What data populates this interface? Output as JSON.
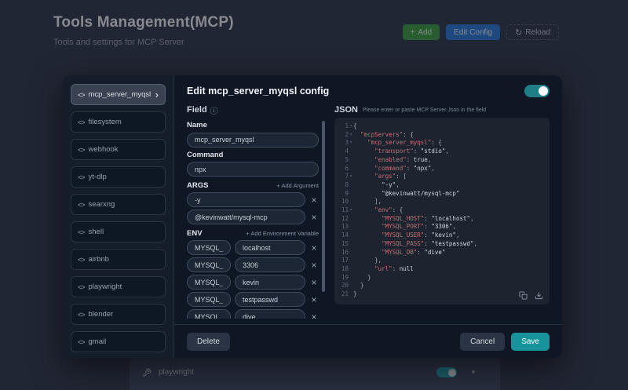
{
  "icons": {
    "code": "<>",
    "chevron": "›",
    "info": "ⓘ",
    "reload": "↻",
    "plus": "+",
    "caret": "▼",
    "close": "×",
    "fold": "▾"
  },
  "colors": {
    "accent_teal": "#18929b",
    "toggle_teal": "#1f7e87",
    "add_green": "#43a047",
    "edit_blue": "#2e7cd6",
    "key_red": "#c96b74"
  },
  "page": {
    "title": "Tools Management(MCP)",
    "subtitle": "Tools and settings for MCP Server",
    "buttons": {
      "add": "Add",
      "edit_config": "Edit Config",
      "reload": "Reload"
    }
  },
  "background": {
    "tool_row": {
      "label": "playwright",
      "toggle_on": true
    }
  },
  "modal": {
    "title": "Edit mcp_server_myqsl config",
    "toggle_on": true,
    "sidebar": {
      "items": [
        {
          "label": "mcp_server_myqsl",
          "selected": true
        },
        {
          "label": "filesystem",
          "selected": false
        },
        {
          "label": "webhook",
          "selected": false
        },
        {
          "label": "yt-dlp",
          "selected": false
        },
        {
          "label": "searxng",
          "selected": false
        },
        {
          "label": "shell",
          "selected": false
        },
        {
          "label": "airbnb",
          "selected": false
        },
        {
          "label": "playwright",
          "selected": false
        },
        {
          "label": "blender",
          "selected": false
        },
        {
          "label": "gmail",
          "selected": false
        }
      ]
    },
    "field": {
      "section_label": "Field",
      "name_label": "Name",
      "name_value": "mcp_server_myqsl",
      "command_label": "Command",
      "command_value": "npx",
      "args_label": "ARGS",
      "add_argument": "+ Add Argument",
      "args": [
        "-y",
        "@kevinwatt/mysql-mcp"
      ],
      "env_label": "ENV",
      "add_env": "+ Add Environment Variable",
      "env": [
        {
          "key": "MYSQL_HOST",
          "value": "localhost"
        },
        {
          "key": "MYSQL_PORT",
          "value": "3306"
        },
        {
          "key": "MYSQL_USER",
          "value": "kevin"
        },
        {
          "key": "MYSQL_PASS",
          "value": "testpasswd"
        },
        {
          "key": "MYSQL_DB",
          "value": "dive"
        }
      ]
    },
    "json_panel": {
      "label": "JSON",
      "hint": "Please enter or paste MCP Server Json in the field",
      "lines": [
        {
          "n": 1,
          "fold": true,
          "t": [
            [
              "p",
              "{"
            ]
          ]
        },
        {
          "n": 2,
          "fold": true,
          "t": [
            [
              "p",
              "  "
            ],
            [
              "k",
              "\"mcpServers\""
            ],
            [
              "p",
              ": {"
            ]
          ]
        },
        {
          "n": 3,
          "fold": true,
          "t": [
            [
              "p",
              "    "
            ],
            [
              "k",
              "\"mcp_server_myqsl\""
            ],
            [
              "p",
              ": {"
            ]
          ]
        },
        {
          "n": 4,
          "fold": false,
          "t": [
            [
              "p",
              "      "
            ],
            [
              "k",
              "\"transport\""
            ],
            [
              "p",
              ": "
            ],
            [
              "s",
              "\"stdio\""
            ],
            [
              "p",
              ","
            ]
          ]
        },
        {
          "n": 5,
          "fold": false,
          "t": [
            [
              "p",
              "      "
            ],
            [
              "k",
              "\"enabled\""
            ],
            [
              "p",
              ": "
            ],
            [
              "w",
              "true"
            ],
            [
              "p",
              ","
            ]
          ]
        },
        {
          "n": 6,
          "fold": false,
          "t": [
            [
              "p",
              "      "
            ],
            [
              "k",
              "\"command\""
            ],
            [
              "p",
              ": "
            ],
            [
              "s",
              "\"npx\""
            ],
            [
              "p",
              ","
            ]
          ]
        },
        {
          "n": 7,
          "fold": true,
          "t": [
            [
              "p",
              "      "
            ],
            [
              "k",
              "\"args\""
            ],
            [
              "p",
              ": ["
            ]
          ]
        },
        {
          "n": 8,
          "fold": false,
          "t": [
            [
              "p",
              "        "
            ],
            [
              "s",
              "\"-y\""
            ],
            [
              "p",
              ","
            ]
          ]
        },
        {
          "n": 9,
          "fold": false,
          "t": [
            [
              "p",
              "        "
            ],
            [
              "s",
              "\"@kevinwatt/mysql-mcp\""
            ]
          ]
        },
        {
          "n": 10,
          "fold": false,
          "t": [
            [
              "p",
              "      ],"
            ]
          ]
        },
        {
          "n": 11,
          "fold": true,
          "t": [
            [
              "p",
              "      "
            ],
            [
              "k",
              "\"env\""
            ],
            [
              "p",
              ": {"
            ]
          ]
        },
        {
          "n": 12,
          "fold": false,
          "t": [
            [
              "p",
              "        "
            ],
            [
              "k",
              "\"MYSQL_HOST\""
            ],
            [
              "p",
              ": "
            ],
            [
              "s",
              "\"localhost\""
            ],
            [
              "p",
              ","
            ]
          ]
        },
        {
          "n": 13,
          "fold": false,
          "t": [
            [
              "p",
              "        "
            ],
            [
              "k",
              "\"MYSQL_PORT\""
            ],
            [
              "p",
              ": "
            ],
            [
              "s",
              "\"3306\""
            ],
            [
              "p",
              ","
            ]
          ]
        },
        {
          "n": 14,
          "fold": false,
          "t": [
            [
              "p",
              "        "
            ],
            [
              "k",
              "\"MYSQL_USER\""
            ],
            [
              "p",
              ": "
            ],
            [
              "s",
              "\"kevin\""
            ],
            [
              "p",
              ","
            ]
          ]
        },
        {
          "n": 15,
          "fold": false,
          "t": [
            [
              "p",
              "        "
            ],
            [
              "k",
              "\"MYSQL_PASS\""
            ],
            [
              "p",
              ": "
            ],
            [
              "s",
              "\"testpasswd\""
            ],
            [
              "p",
              ","
            ]
          ]
        },
        {
          "n": 16,
          "fold": false,
          "t": [
            [
              "p",
              "        "
            ],
            [
              "k",
              "\"MYSQL_DB\""
            ],
            [
              "p",
              ": "
            ],
            [
              "s",
              "\"dive\""
            ]
          ]
        },
        {
          "n": 17,
          "fold": false,
          "t": [
            [
              "p",
              "      },"
            ]
          ]
        },
        {
          "n": 18,
          "fold": false,
          "t": [
            [
              "p",
              "      "
            ],
            [
              "k",
              "\"url\""
            ],
            [
              "p",
              ": "
            ],
            [
              "w",
              "null"
            ]
          ]
        },
        {
          "n": 19,
          "fold": false,
          "t": [
            [
              "p",
              "    }"
            ]
          ]
        },
        {
          "n": 20,
          "fold": false,
          "t": [
            [
              "p",
              "  }"
            ]
          ]
        },
        {
          "n": 21,
          "fold": false,
          "t": [
            [
              "p",
              "}"
            ]
          ]
        }
      ]
    },
    "footer": {
      "delete": "Delete",
      "cancel": "Cancel",
      "save": "Save"
    }
  }
}
